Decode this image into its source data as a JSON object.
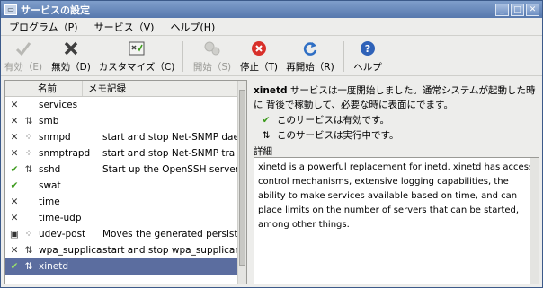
{
  "window": {
    "title": "サービスの設定"
  },
  "menu": [
    {
      "label": "プログラム（P)"
    },
    {
      "label": "サービス（V)"
    },
    {
      "label": "ヘルプ(H)"
    }
  ],
  "toolbar": {
    "enable": "有効（E)",
    "disable": "無効（D)",
    "customize": "カスタマイズ（C)",
    "start": "開始（S)",
    "stop": "停止（T)",
    "restart": "再開始（R)",
    "help": "ヘルプ"
  },
  "list": {
    "col_name": "名前",
    "col_memo": "メモ記録",
    "rows": [
      {
        "name": "services",
        "memo": "",
        "enabled": "x",
        "running": ""
      },
      {
        "name": "smb",
        "memo": "",
        "enabled": "x",
        "running": "run"
      },
      {
        "name": "snmpd",
        "memo": "start and stop Net-SNMP dae",
        "enabled": "x",
        "running": "stop"
      },
      {
        "name": "snmptrapd",
        "memo": "start and stop Net-SNMP tra",
        "enabled": "x",
        "running": "stop"
      },
      {
        "name": "sshd",
        "memo": "Start up the OpenSSH server c",
        "enabled": "check",
        "running": "run"
      },
      {
        "name": "swat",
        "memo": "",
        "enabled": "check",
        "running": ""
      },
      {
        "name": "time",
        "memo": "",
        "enabled": "x",
        "running": ""
      },
      {
        "name": "time-udp",
        "memo": "",
        "enabled": "x",
        "running": ""
      },
      {
        "name": "udev-post",
        "memo": "Moves the generated persiste",
        "enabled": "custom",
        "running": "stop"
      },
      {
        "name": "wpa_supplicant",
        "memo": "start and stop wpa_supplicar",
        "enabled": "x",
        "running": "run"
      },
      {
        "name": "xinetd",
        "memo": "",
        "enabled": "check",
        "running": "run",
        "selected": true
      }
    ]
  },
  "detail": {
    "service_name": "xinetd",
    "description": "サービスは一度開始しました。通常システムが起動した時に 背後で稼動して、必要な時に表面にでます。",
    "enabled_text": "このサービスは有効です。",
    "running_text": "このサービスは実行中です。",
    "details_label": "詳細",
    "details_text": "xinetd is a powerful replacement for inetd. xinetd has access control mechanisms, extensive logging capabilities, the ability to make services available based on time, and can place limits on the number of servers that can be started, among other things."
  }
}
